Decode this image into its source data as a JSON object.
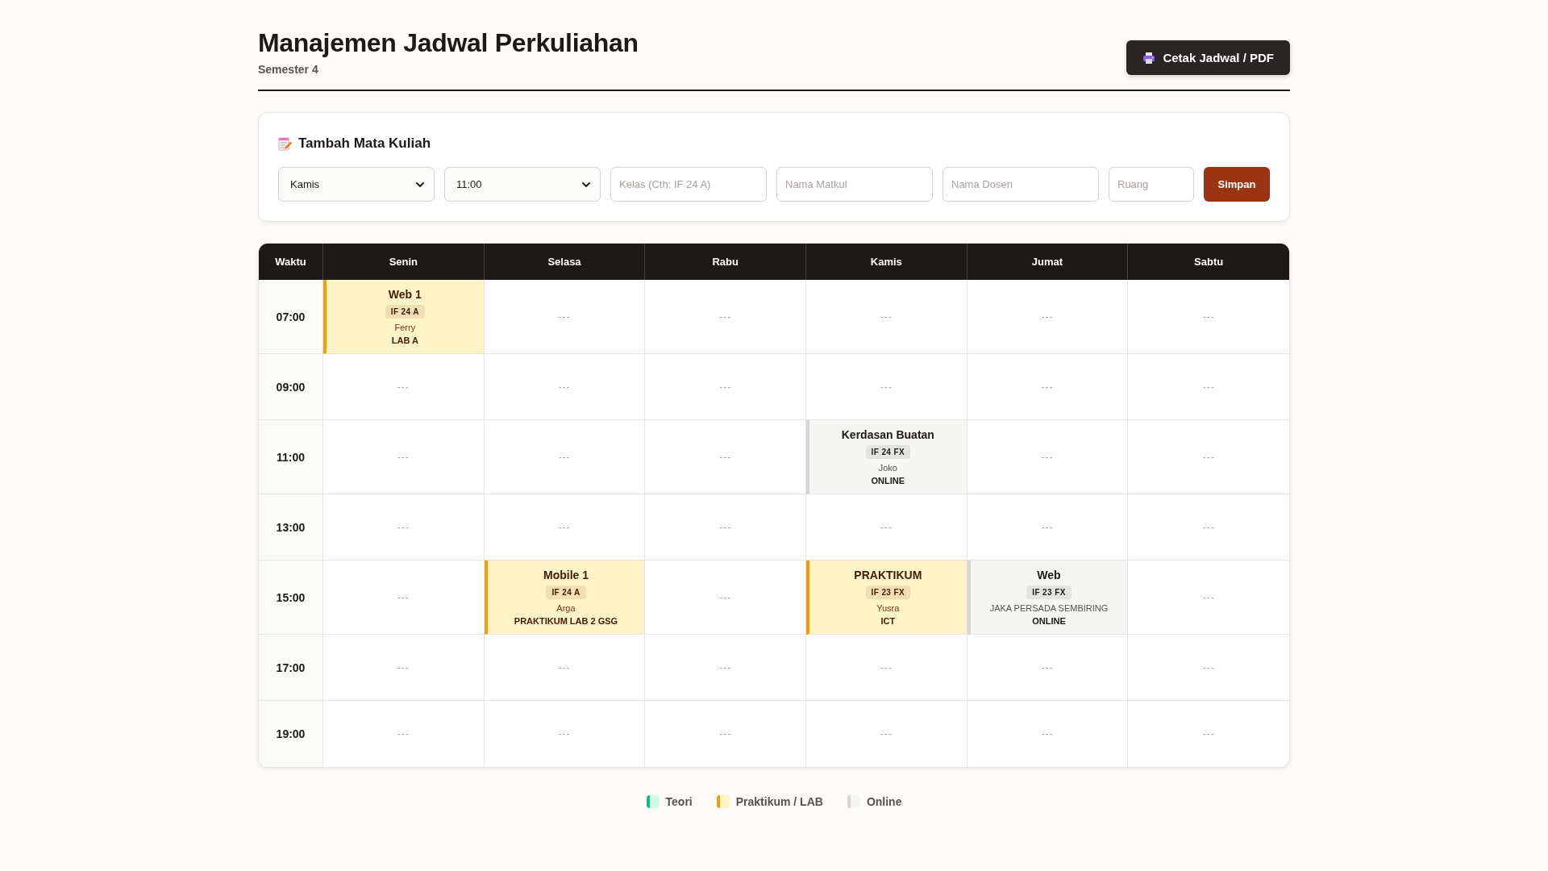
{
  "header": {
    "title": "Manajemen Jadwal Perkuliahan",
    "subtitle": "Semester 4",
    "print_button": "Cetak Jadwal / PDF"
  },
  "form": {
    "title": "Tambah Mata Kuliah",
    "fields": [
      {
        "kind": "select",
        "value": "Kamis"
      },
      {
        "kind": "select",
        "value": "11:00"
      },
      {
        "kind": "input",
        "placeholder": "Kelas (Cth: IF 24 A)"
      },
      {
        "kind": "input",
        "placeholder": "Nama Matkul"
      },
      {
        "kind": "input",
        "placeholder": "Nama Dosen"
      },
      {
        "kind": "input",
        "placeholder": "Ruang"
      }
    ],
    "submit": "Simpan"
  },
  "table": {
    "columns": [
      "Waktu",
      "Senin",
      "Selasa",
      "Rabu",
      "Kamis",
      "Jumat",
      "Sabtu"
    ],
    "rows": [
      {
        "cells": [
          {
            "kind": "time",
            "text": "07:00"
          },
          {
            "kind": "praktikum",
            "title": "Web 1",
            "class": "IF 24 A",
            "lecturer": "Ferry",
            "room": "LAB A"
          },
          {
            "kind": "empty",
            "text": "---"
          },
          {
            "kind": "empty",
            "text": "---"
          },
          {
            "kind": "empty",
            "text": "---"
          },
          {
            "kind": "empty",
            "text": "---"
          },
          {
            "kind": "empty",
            "text": "---"
          }
        ]
      },
      {
        "cells": [
          {
            "kind": "time",
            "text": "09:00"
          },
          {
            "kind": "empty",
            "text": "---"
          },
          {
            "kind": "empty",
            "text": "---"
          },
          {
            "kind": "empty",
            "text": "---"
          },
          {
            "kind": "empty",
            "text": "---"
          },
          {
            "kind": "empty",
            "text": "---"
          },
          {
            "kind": "empty",
            "text": "---"
          }
        ]
      },
      {
        "cells": [
          {
            "kind": "time",
            "text": "11:00"
          },
          {
            "kind": "empty",
            "text": "---"
          },
          {
            "kind": "empty",
            "text": "---"
          },
          {
            "kind": "empty",
            "text": "---"
          },
          {
            "kind": "online",
            "title": "Kerdasan Buatan",
            "class": "IF 24 FX",
            "lecturer": "Joko",
            "room": "ONLINE"
          },
          {
            "kind": "empty",
            "text": "---"
          },
          {
            "kind": "empty",
            "text": "---"
          }
        ]
      },
      {
        "cells": [
          {
            "kind": "time",
            "text": "13:00"
          },
          {
            "kind": "empty",
            "text": "---"
          },
          {
            "kind": "empty",
            "text": "---"
          },
          {
            "kind": "empty",
            "text": "---"
          },
          {
            "kind": "empty",
            "text": "---"
          },
          {
            "kind": "empty",
            "text": "---"
          },
          {
            "kind": "empty",
            "text": "---"
          }
        ]
      },
      {
        "cells": [
          {
            "kind": "time",
            "text": "15:00"
          },
          {
            "kind": "empty",
            "text": "---"
          },
          {
            "kind": "praktikum",
            "title": "Mobile 1",
            "class": "IF 24 A",
            "lecturer": "Arga",
            "room": "PRAKTIKUM LAB 2 GSG"
          },
          {
            "kind": "empty",
            "text": "---"
          },
          {
            "kind": "praktikum",
            "title": "PRAKTIKUM",
            "class": "IF 23 FX",
            "lecturer": "Yusra",
            "room": "ICT"
          },
          {
            "kind": "online",
            "title": "Web",
            "class": "IF 23 FX",
            "lecturer": "JAKA PERSADA SEMBIRING",
            "room": "ONLINE"
          },
          {
            "kind": "empty",
            "text": "---"
          }
        ]
      },
      {
        "cells": [
          {
            "kind": "time",
            "text": "17:00"
          },
          {
            "kind": "empty",
            "text": "---"
          },
          {
            "kind": "empty",
            "text": "---"
          },
          {
            "kind": "empty",
            "text": "---"
          },
          {
            "kind": "empty",
            "text": "---"
          },
          {
            "kind": "empty",
            "text": "---"
          },
          {
            "kind": "empty",
            "text": "---"
          }
        ]
      },
      {
        "cells": [
          {
            "kind": "time",
            "text": "19:00"
          },
          {
            "kind": "empty",
            "text": "---"
          },
          {
            "kind": "empty",
            "text": "---"
          },
          {
            "kind": "empty",
            "text": "---"
          },
          {
            "kind": "empty",
            "text": "---"
          },
          {
            "kind": "empty",
            "text": "---"
          },
          {
            "kind": "empty",
            "text": "---"
          }
        ]
      }
    ]
  },
  "legend": [
    {
      "kind": "teori",
      "label": "Teori"
    },
    {
      "kind": "praktikum",
      "label": "Praktikum / LAB"
    },
    {
      "kind": "online",
      "label": "Online"
    }
  ]
}
